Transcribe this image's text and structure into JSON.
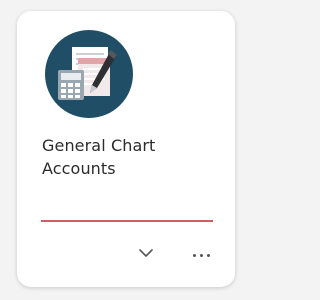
{
  "tile": {
    "title": "General Chart Accounts",
    "icon": "calculator-document-pen-icon",
    "accent_color": "#d45a63"
  },
  "actions": {
    "expand_icon": "chevron-down-icon",
    "more_icon": "more-horizontal-icon"
  }
}
